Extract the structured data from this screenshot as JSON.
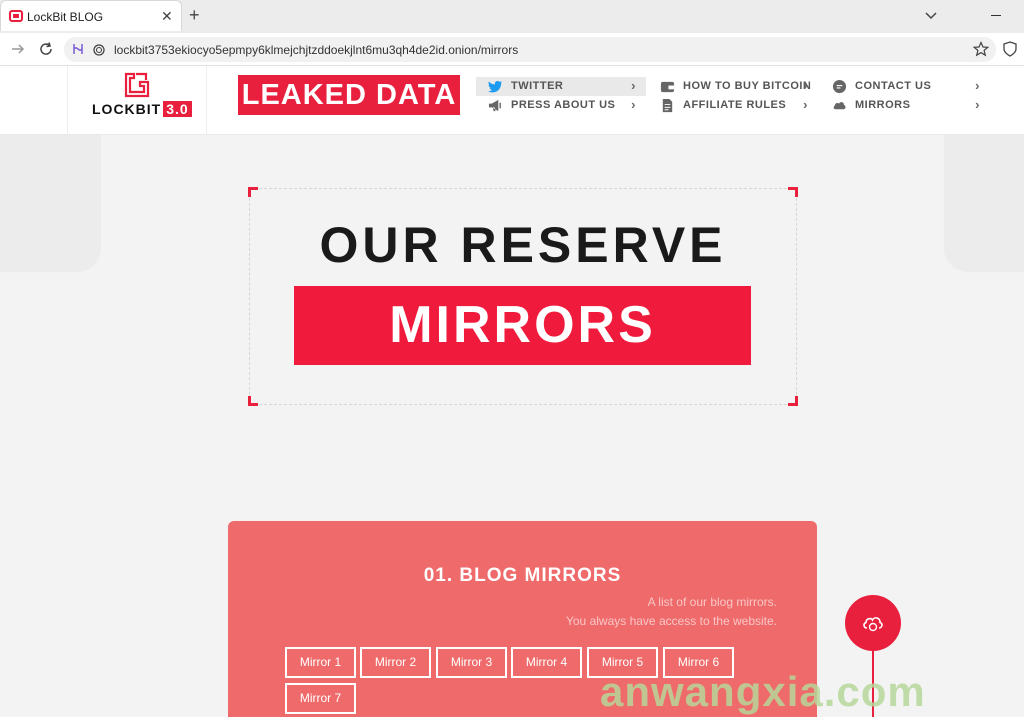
{
  "browser": {
    "tab_title": "LockBit BLOG",
    "tab_close": "✕",
    "new_tab": "+",
    "url": "lockbit3753ekiocyo5epmpy6klmejchjtzddoekjlnt6mu3qh4de2id.onion/mirrors"
  },
  "header": {
    "logo_text": "LOCKBIT",
    "logo_badge": "3.0",
    "banner": "LEAKED DATA",
    "menu": [
      {
        "label": "TWITTER",
        "icon": "twitter-icon",
        "arrow": "›"
      },
      {
        "label": "PRESS ABOUT US",
        "icon": "megaphone-icon",
        "arrow": "›"
      },
      {
        "label": "HOW TO BUY BITCOIN",
        "icon": "wallet-icon",
        "arrow": "›"
      },
      {
        "label": "AFFILIATE RULES",
        "icon": "document-icon",
        "arrow": "›"
      },
      {
        "label": "CONTACT US",
        "icon": "chat-icon",
        "arrow": "›"
      },
      {
        "label": "MIRRORS",
        "icon": "cloud-icon",
        "arrow": "›"
      }
    ]
  },
  "hero": {
    "title": "OUR RESERVE",
    "subtitle": "MIRRORS"
  },
  "mirrors_section": {
    "title": "01. BLOG MIRRORS",
    "desc_line1": "A list of our blog mirrors.",
    "desc_line2": "You always have access to the website.",
    "mirrors": [
      "Mirror 1",
      "Mirror 2",
      "Mirror 3",
      "Mirror 4",
      "Mirror 5",
      "Mirror 6",
      "Mirror 7"
    ]
  },
  "watermark": "anwangxia.com",
  "colors": {
    "accent": "#e8203e",
    "card": "#ef6a6a",
    "background": "#f3f3f3",
    "watermark": "#b7d79a"
  }
}
